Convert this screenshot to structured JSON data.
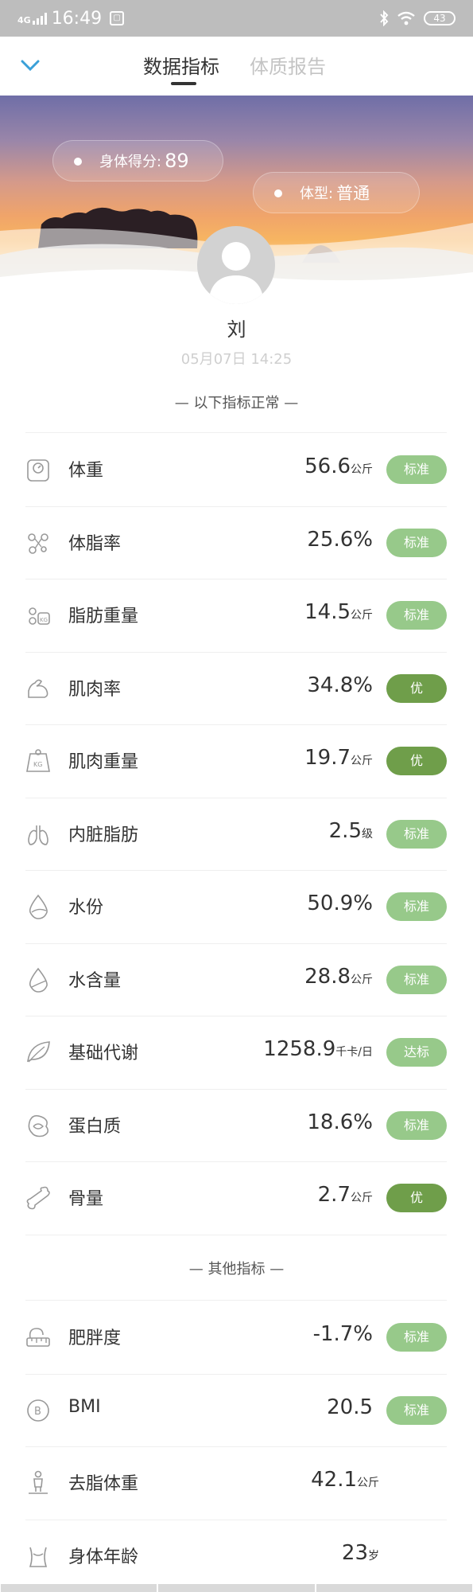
{
  "status_bar": {
    "network": "4G",
    "time": "16:49",
    "sim_icon": "sim-icon",
    "battery": "43"
  },
  "header": {
    "tabs": [
      {
        "label": "数据指标",
        "active": true
      },
      {
        "label": "体质报告",
        "active": false
      }
    ],
    "accent_color": "#3aa0d8"
  },
  "banner": {
    "score_label": "身体得分:",
    "score_value": "89",
    "type_label": "体型:",
    "type_value": "普通"
  },
  "profile": {
    "name": "刘",
    "timestamp": "05月07日 14:25"
  },
  "sections": [
    {
      "title": "— 以下指标正常 —",
      "items": [
        {
          "icon": "scale-icon",
          "label": "体重",
          "value": "56.6",
          "unit": "公斤",
          "badge": "标准",
          "badge_color": "#97c98a"
        },
        {
          "icon": "fat-molecule-icon",
          "label": "体脂率",
          "value": "25.6%",
          "unit": "",
          "badge": "标准",
          "badge_color": "#97c98a"
        },
        {
          "icon": "fat-weight-icon",
          "label": "脂肪重量",
          "value": "14.5",
          "unit": "公斤",
          "badge": "标准",
          "badge_color": "#97c98a"
        },
        {
          "icon": "arm-muscle-icon",
          "label": "肌肉率",
          "value": "34.8%",
          "unit": "",
          "badge": "优",
          "badge_color": "#6f9e4a"
        },
        {
          "icon": "muscle-weight-icon",
          "label": "肌肉重量",
          "value": "19.7",
          "unit": "公斤",
          "badge": "优",
          "badge_color": "#6f9e4a"
        },
        {
          "icon": "lungs-icon",
          "label": "内脏脂肪",
          "value": "2.5",
          "unit": "级",
          "badge": "标准",
          "badge_color": "#97c98a"
        },
        {
          "icon": "water-drop-icon",
          "label": "水份",
          "value": "50.9%",
          "unit": "",
          "badge": "标准",
          "badge_color": "#97c98a"
        },
        {
          "icon": "water-content-icon",
          "label": "水含量",
          "value": "28.8",
          "unit": "公斤",
          "badge": "标准",
          "badge_color": "#97c98a"
        },
        {
          "icon": "leaf-icon",
          "label": "基础代谢",
          "value": "1258.9",
          "unit": "千卡/日",
          "badge": "达标",
          "badge_color": "#97c98a"
        },
        {
          "icon": "protein-icon",
          "label": "蛋白质",
          "value": "18.6%",
          "unit": "",
          "badge": "标准",
          "badge_color": "#97c98a"
        },
        {
          "icon": "bone-icon",
          "label": "骨量",
          "value": "2.7",
          "unit": "公斤",
          "badge": "优",
          "badge_color": "#6f9e4a"
        }
      ]
    },
    {
      "title": "— 其他指标 —",
      "items": [
        {
          "icon": "body-fat-ruler-icon",
          "label": "肥胖度",
          "value": "-1.7%",
          "unit": "",
          "badge": "标准",
          "badge_color": "#97c98a"
        },
        {
          "icon": "bmi-icon",
          "label": "BMI",
          "value": "20.5",
          "unit": "",
          "badge": "标准",
          "badge_color": "#97c98a"
        },
        {
          "icon": "person-scale-icon",
          "label": "去脂体重",
          "value": "42.1",
          "unit": "公斤",
          "badge": "",
          "badge_color": ""
        },
        {
          "icon": "body-age-icon",
          "label": "身体年龄",
          "value": "23",
          "unit": "岁",
          "badge": "",
          "badge_color": ""
        }
      ]
    }
  ]
}
